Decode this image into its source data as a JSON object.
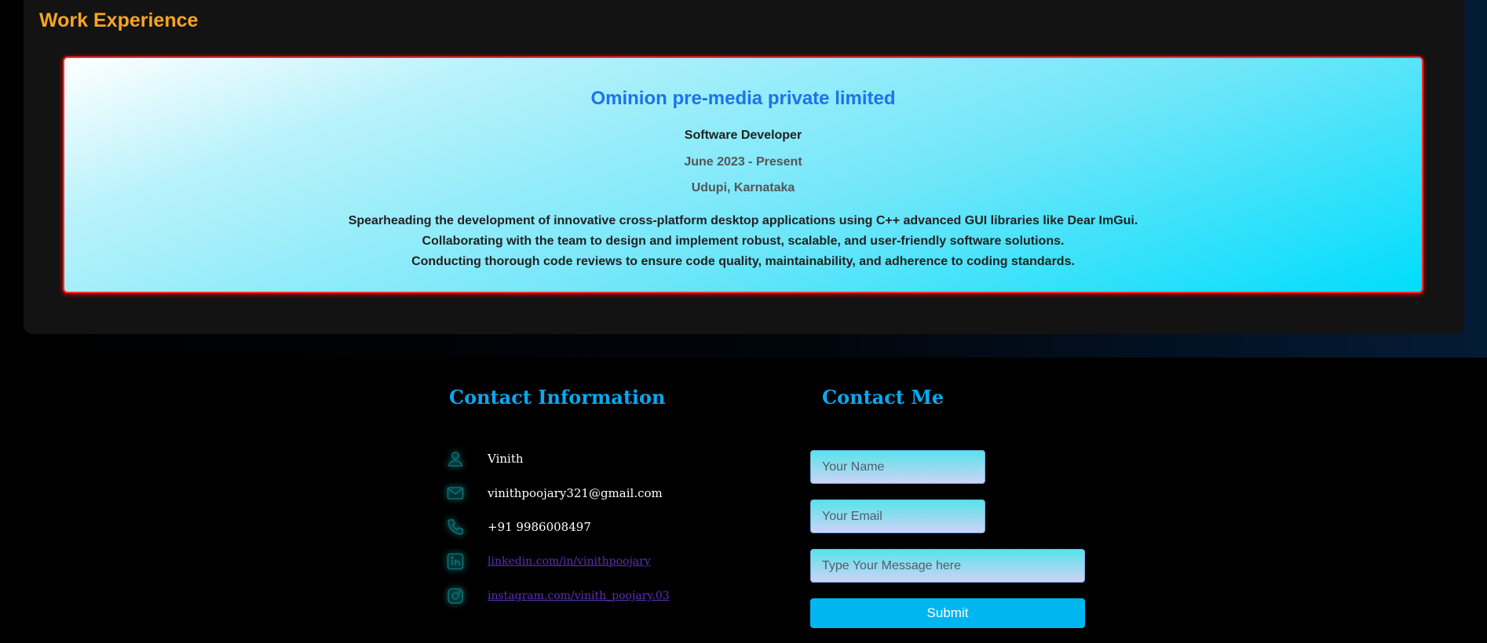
{
  "work": {
    "title": "Work Experience",
    "company": "Ominion pre-media private limited",
    "role": "Software Developer",
    "dates": "June 2023 - Present",
    "location": "Udupi, Karnataka",
    "duties": [
      "Spearheading the development of innovative cross-platform desktop applications using C++ advanced GUI libraries like Dear ImGui.",
      "Collaborating with the team to design and implement robust, scalable, and user-friendly software solutions.",
      "Conducting thorough code reviews to ensure code quality, maintainability, and adherence to coding standards."
    ]
  },
  "contact_info": {
    "title": "Contact Information",
    "name": "Vinith",
    "email": "vinithpoojary321@gmail.com",
    "phone": "+91 9986008497",
    "linkedin": "linkedin.com/in/vinithpoojary",
    "instagram": "instagram.com/vinith_poojary.03"
  },
  "contact_form": {
    "title": "Contact Me",
    "name_placeholder": "Your Name",
    "email_placeholder": "Your Email",
    "message_placeholder": "Type Your Message here",
    "submit_label": "Submit"
  },
  "colors": {
    "section_title": "#f5a623",
    "company": "#1e73e8",
    "contact_heading": "#08a8f2",
    "icon_glow": "#13d4d4",
    "submit": "#00b6f0",
    "link": "#5b2fb8"
  },
  "icons": [
    "user-icon",
    "mail-icon",
    "phone-icon",
    "linkedin-icon",
    "instagram-icon"
  ]
}
